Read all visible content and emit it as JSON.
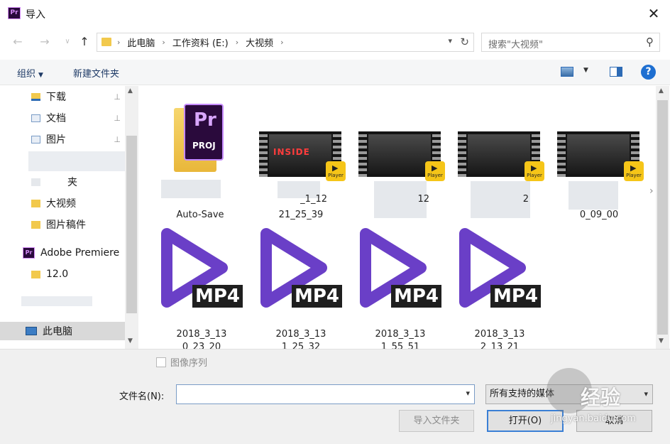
{
  "window": {
    "title": "导入",
    "app_icon_text": "Pr",
    "close_glyph": "✕"
  },
  "navigation": {
    "back_glyph": "←",
    "forward_glyph": "→",
    "recent_glyph": "∨",
    "up_glyph": "↑",
    "breadcrumbs": [
      "此电脑",
      "工作资料 (E:)",
      "大视频"
    ],
    "crumb_separator": "›",
    "search_placeholder": "搜索\"大视频\""
  },
  "toolbar": {
    "organize_label": "组织",
    "new_folder_label": "新建文件夹",
    "help_glyph": "?"
  },
  "sidebar": {
    "items": [
      {
        "label": "下载",
        "pinned": true
      },
      {
        "label": "文档",
        "pinned": true
      },
      {
        "label": "图片",
        "pinned": true
      },
      {
        "label": "夹",
        "pinned": false
      },
      {
        "label": "大视频",
        "pinned": false
      },
      {
        "label": "图片稿件",
        "pinned": false
      },
      {
        "label": "Adobe Premiere",
        "pinned": false
      },
      {
        "label": "12.0",
        "pinned": false
      },
      {
        "label": "此电脑",
        "pinned": false,
        "selected": true
      }
    ],
    "pin_glyph": "📌"
  },
  "files": {
    "row1": [
      {
        "type": "prproj",
        "thumb_top": "Pr",
        "thumb_bottom": "PROJ",
        "label": "Auto-Save"
      },
      {
        "type": "video",
        "thumb_text": "INSIDE",
        "badge": "Player",
        "label_line1": "_1_12",
        "label_line2": "21_25_39"
      },
      {
        "type": "video",
        "thumb_text": "",
        "badge": "Player",
        "label_line1": "12",
        "label_line2": ""
      },
      {
        "type": "video",
        "thumb_text": "",
        "badge": "Player",
        "label_line1": "2",
        "label_line2": ""
      },
      {
        "type": "video",
        "thumb_text": "",
        "badge": "Player",
        "label_line1": "",
        "label_line2": "0_09_00"
      }
    ],
    "row2": [
      {
        "type": "mp4",
        "badge": "MP4",
        "label_line1": "2018_3_13",
        "label_line2": "0_23_20"
      },
      {
        "type": "mp4",
        "badge": "MP4",
        "label_line1": "2018_3_13",
        "label_line2": "1_25_32"
      },
      {
        "type": "mp4",
        "badge": "MP4",
        "label_line1": "2018_3_13",
        "label_line2": "1_55_51"
      },
      {
        "type": "mp4",
        "badge": "MP4",
        "label_line1": "2018_3_13",
        "label_line2": "2_13_21"
      }
    ]
  },
  "bottom": {
    "image_sequence_label": "图像序列",
    "filename_label": "文件名(N):",
    "filename_value": "",
    "filetype_value": "所有支持的媒体",
    "import_folder_label": "导入文件夹",
    "open_label": "打开(O)",
    "cancel_label": "取消"
  },
  "watermark": {
    "text": "经验",
    "url": "jingyan.baidu.com"
  },
  "colors": {
    "accent": "#3a7fd5",
    "premiere_purple": "#c68bff",
    "mp4_purple": "#6a3fc7",
    "folder_yellow": "#f2c94c"
  }
}
